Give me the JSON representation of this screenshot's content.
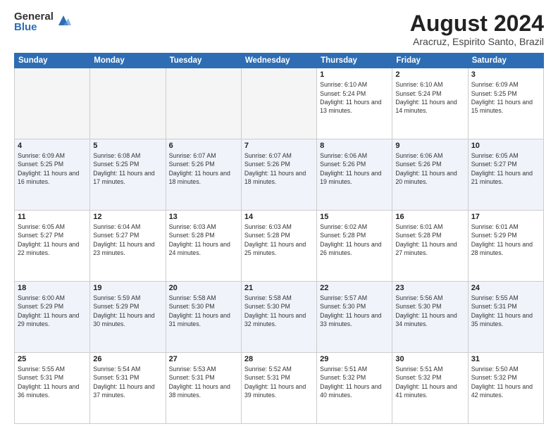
{
  "header": {
    "logo_general": "General",
    "logo_blue": "Blue",
    "month_title": "August 2024",
    "location": "Aracruz, Espirito Santo, Brazil"
  },
  "weekdays": [
    "Sunday",
    "Monday",
    "Tuesday",
    "Wednesday",
    "Thursday",
    "Friday",
    "Saturday"
  ],
  "weeks": [
    [
      {
        "day": "",
        "info": ""
      },
      {
        "day": "",
        "info": ""
      },
      {
        "day": "",
        "info": ""
      },
      {
        "day": "",
        "info": ""
      },
      {
        "day": "1",
        "info": "Sunrise: 6:10 AM\nSunset: 5:24 PM\nDaylight: 11 hours\nand 13 minutes."
      },
      {
        "day": "2",
        "info": "Sunrise: 6:10 AM\nSunset: 5:24 PM\nDaylight: 11 hours\nand 14 minutes."
      },
      {
        "day": "3",
        "info": "Sunrise: 6:09 AM\nSunset: 5:25 PM\nDaylight: 11 hours\nand 15 minutes."
      }
    ],
    [
      {
        "day": "4",
        "info": "Sunrise: 6:09 AM\nSunset: 5:25 PM\nDaylight: 11 hours\nand 16 minutes."
      },
      {
        "day": "5",
        "info": "Sunrise: 6:08 AM\nSunset: 5:25 PM\nDaylight: 11 hours\nand 17 minutes."
      },
      {
        "day": "6",
        "info": "Sunrise: 6:07 AM\nSunset: 5:26 PM\nDaylight: 11 hours\nand 18 minutes."
      },
      {
        "day": "7",
        "info": "Sunrise: 6:07 AM\nSunset: 5:26 PM\nDaylight: 11 hours\nand 18 minutes."
      },
      {
        "day": "8",
        "info": "Sunrise: 6:06 AM\nSunset: 5:26 PM\nDaylight: 11 hours\nand 19 minutes."
      },
      {
        "day": "9",
        "info": "Sunrise: 6:06 AM\nSunset: 5:26 PM\nDaylight: 11 hours\nand 20 minutes."
      },
      {
        "day": "10",
        "info": "Sunrise: 6:05 AM\nSunset: 5:27 PM\nDaylight: 11 hours\nand 21 minutes."
      }
    ],
    [
      {
        "day": "11",
        "info": "Sunrise: 6:05 AM\nSunset: 5:27 PM\nDaylight: 11 hours\nand 22 minutes."
      },
      {
        "day": "12",
        "info": "Sunrise: 6:04 AM\nSunset: 5:27 PM\nDaylight: 11 hours\nand 23 minutes."
      },
      {
        "day": "13",
        "info": "Sunrise: 6:03 AM\nSunset: 5:28 PM\nDaylight: 11 hours\nand 24 minutes."
      },
      {
        "day": "14",
        "info": "Sunrise: 6:03 AM\nSunset: 5:28 PM\nDaylight: 11 hours\nand 25 minutes."
      },
      {
        "day": "15",
        "info": "Sunrise: 6:02 AM\nSunset: 5:28 PM\nDaylight: 11 hours\nand 26 minutes."
      },
      {
        "day": "16",
        "info": "Sunrise: 6:01 AM\nSunset: 5:28 PM\nDaylight: 11 hours\nand 27 minutes."
      },
      {
        "day": "17",
        "info": "Sunrise: 6:01 AM\nSunset: 5:29 PM\nDaylight: 11 hours\nand 28 minutes."
      }
    ],
    [
      {
        "day": "18",
        "info": "Sunrise: 6:00 AM\nSunset: 5:29 PM\nDaylight: 11 hours\nand 29 minutes."
      },
      {
        "day": "19",
        "info": "Sunrise: 5:59 AM\nSunset: 5:29 PM\nDaylight: 11 hours\nand 30 minutes."
      },
      {
        "day": "20",
        "info": "Sunrise: 5:58 AM\nSunset: 5:30 PM\nDaylight: 11 hours\nand 31 minutes."
      },
      {
        "day": "21",
        "info": "Sunrise: 5:58 AM\nSunset: 5:30 PM\nDaylight: 11 hours\nand 32 minutes."
      },
      {
        "day": "22",
        "info": "Sunrise: 5:57 AM\nSunset: 5:30 PM\nDaylight: 11 hours\nand 33 minutes."
      },
      {
        "day": "23",
        "info": "Sunrise: 5:56 AM\nSunset: 5:30 PM\nDaylight: 11 hours\nand 34 minutes."
      },
      {
        "day": "24",
        "info": "Sunrise: 5:55 AM\nSunset: 5:31 PM\nDaylight: 11 hours\nand 35 minutes."
      }
    ],
    [
      {
        "day": "25",
        "info": "Sunrise: 5:55 AM\nSunset: 5:31 PM\nDaylight: 11 hours\nand 36 minutes."
      },
      {
        "day": "26",
        "info": "Sunrise: 5:54 AM\nSunset: 5:31 PM\nDaylight: 11 hours\nand 37 minutes."
      },
      {
        "day": "27",
        "info": "Sunrise: 5:53 AM\nSunset: 5:31 PM\nDaylight: 11 hours\nand 38 minutes."
      },
      {
        "day": "28",
        "info": "Sunrise: 5:52 AM\nSunset: 5:31 PM\nDaylight: 11 hours\nand 39 minutes."
      },
      {
        "day": "29",
        "info": "Sunrise: 5:51 AM\nSunset: 5:32 PM\nDaylight: 11 hours\nand 40 minutes."
      },
      {
        "day": "30",
        "info": "Sunrise: 5:51 AM\nSunset: 5:32 PM\nDaylight: 11 hours\nand 41 minutes."
      },
      {
        "day": "31",
        "info": "Sunrise: 5:50 AM\nSunset: 5:32 PM\nDaylight: 11 hours\nand 42 minutes."
      }
    ]
  ]
}
